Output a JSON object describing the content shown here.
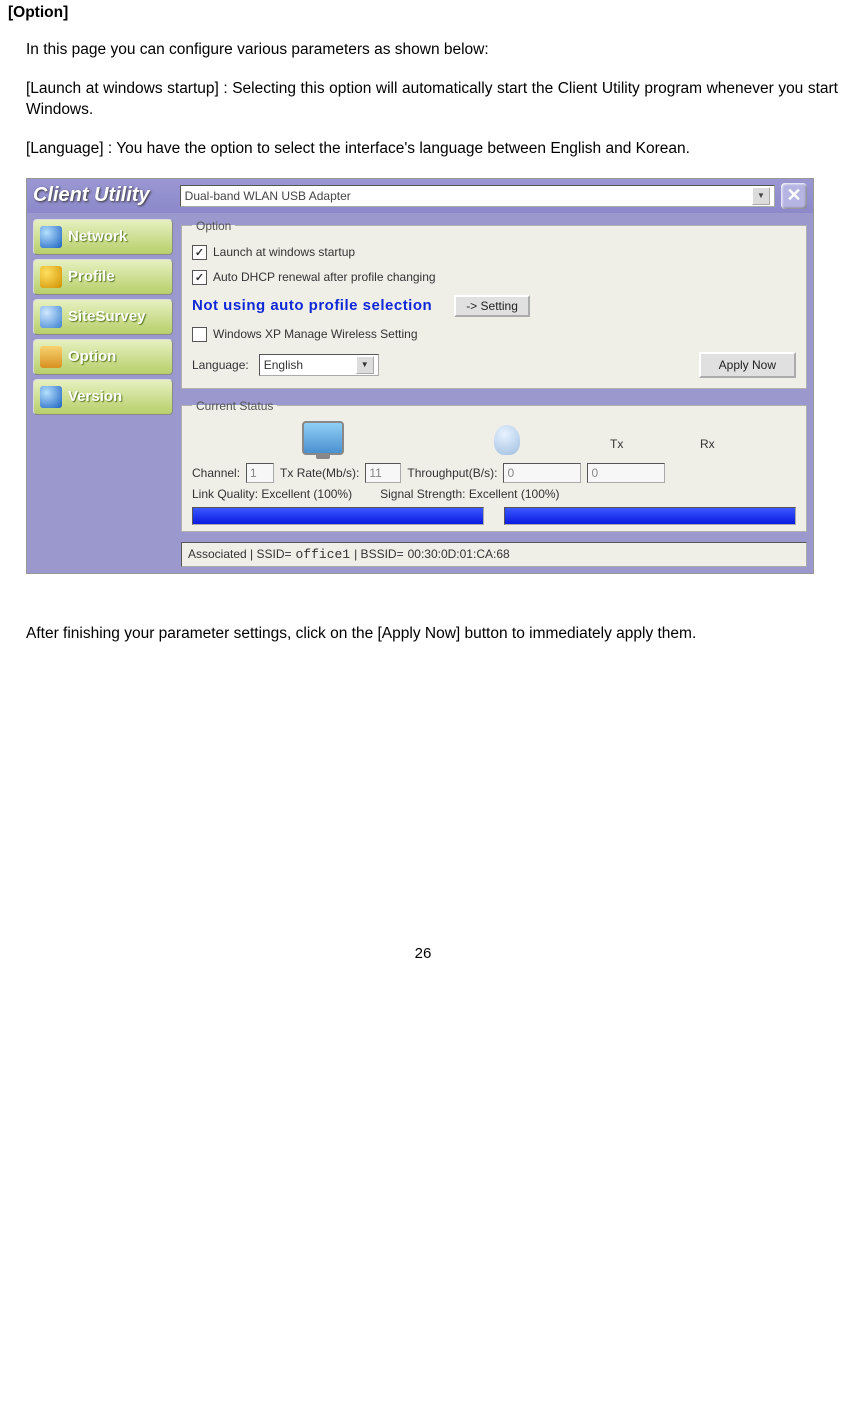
{
  "doc": {
    "section_title": "[Option]",
    "intro": "In this page you can configure various parameters as shown below:",
    "launch_desc": "[Launch at windows startup] : Selecting this option will automatically start the Client Utility program whenever you start Windows.",
    "language_desc": "[Language] : You have the option to select the interface's language between English and Korean.",
    "footer": "After finishing your parameter settings, click on the [Apply Now] button to immediately apply them.",
    "page_number": "26"
  },
  "app": {
    "title": "Client Utility",
    "adapter": "Dual-band WLAN USB Adapter",
    "sidebar": {
      "network": "Network",
      "profile": "Profile",
      "sitesurvey": "SiteSurvey",
      "option": "Option",
      "version": "Version"
    },
    "option_panel": {
      "legend": "Option",
      "launch": "Launch at windows startup",
      "dhcp": "Auto DHCP renewal after profile changing",
      "auto_profile": "Not using auto profile selection",
      "setting_btn": "-> Setting",
      "xp_manage": "Windows XP Manage Wireless Setting",
      "language_label": "Language:",
      "language_value": "English",
      "apply_btn": "Apply Now"
    },
    "status": {
      "legend": "Current Status",
      "channel_label": "Channel:",
      "channel": "1",
      "txrate_label": "Tx Rate(Mb/s):",
      "txrate": "11",
      "throughput_label": "Throughput(B/s):",
      "tx_label": "Tx",
      "rx_label": "Rx",
      "tx": "0",
      "rx": "0",
      "link_quality_label": "Link Quality:",
      "link_quality": "Excellent (100%)",
      "signal_label": "Signal Strength:",
      "signal": "Excellent (100%)",
      "assoc_prefix": "Associated | SSID=",
      "ssid": "office1",
      "bssid_prefix": "| BSSID=",
      "bssid": "00:30:0D:01:CA:68"
    }
  }
}
